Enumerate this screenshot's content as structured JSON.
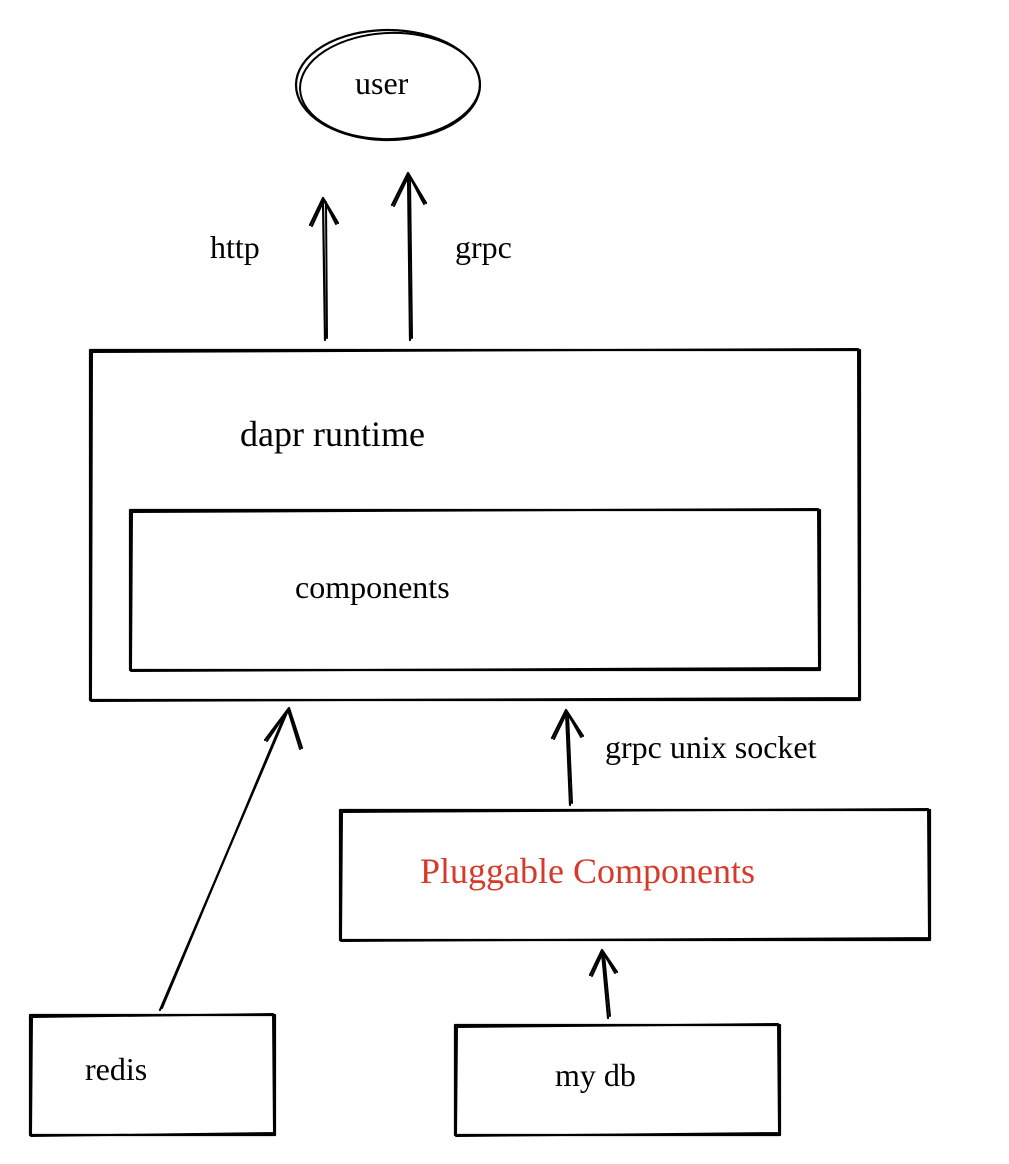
{
  "nodes": {
    "user": {
      "label": "user"
    },
    "dapr_runtime": {
      "label": "dapr runtime"
    },
    "components": {
      "label": "components"
    },
    "pluggable": {
      "label": "Pluggable Components",
      "color": "#d63a2a"
    },
    "redis": {
      "label": "redis"
    },
    "mydb": {
      "label": "my db"
    }
  },
  "edges": {
    "http": {
      "label": "http"
    },
    "grpc": {
      "label": "grpc"
    },
    "grpc_unix_socket": {
      "label": "grpc unix socket"
    }
  }
}
